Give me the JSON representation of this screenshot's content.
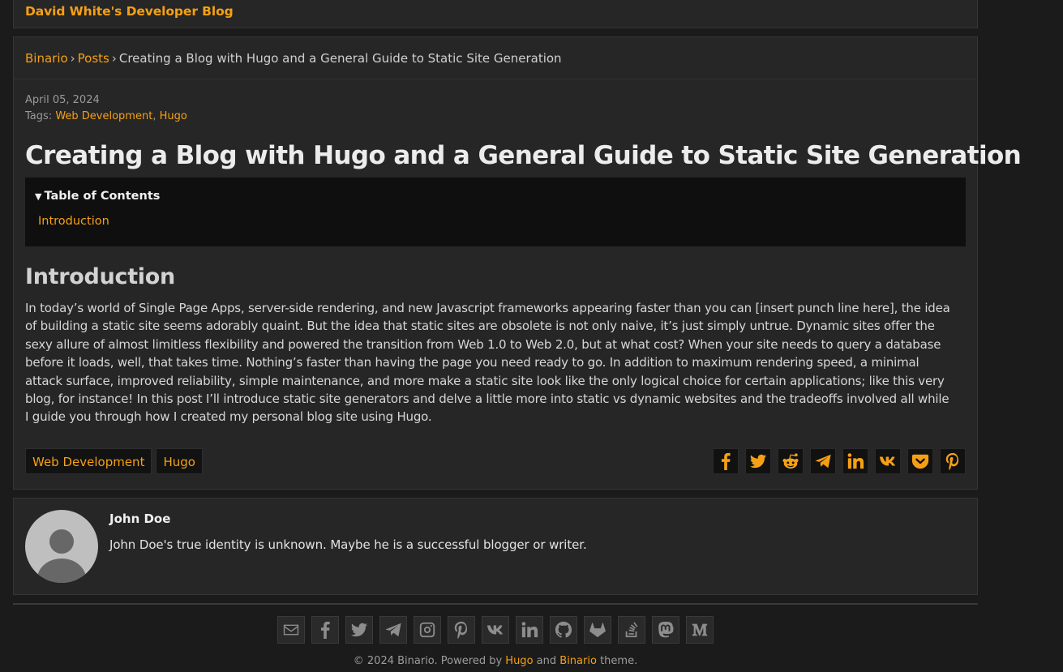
{
  "header": {
    "site_title": "David White's Developer Blog"
  },
  "breadcrumb": {
    "home": "Binario",
    "section": "Posts",
    "current": "Creating a Blog with Hugo and a General Guide to Static Site Generation"
  },
  "meta": {
    "date": "April 05, 2024",
    "tags_label": "Tags:",
    "tags": [
      "Web Development",
      "Hugo"
    ],
    "tag_separator": ","
  },
  "post": {
    "title": "Creating a Blog with Hugo and a General Guide to Static Site Generation",
    "toc": {
      "heading": "Table of Contents",
      "items": [
        "Introduction"
      ]
    },
    "section_title": "Introduction",
    "body": "In today’s world of Single Page Apps, server-side rendering, and new Javascript frameworks appearing faster than you can [insert punch line here], the idea of building a static site seems adorably quaint. But the idea that static sites are obsolete is not only naive, it’s just simply untrue. Dynamic sites offer the sexy allure of almost limitless flexibility and powered the transition from Web 1.0 to Web 2.0, but at what cost? When your site needs to query a database before it loads, well, that takes time. Nothing’s faster than having the page you need ready to go. In addition to maximum rendering speed, a minimal attack surface, improved reliability, simple maintenance, and more make a static site look like the only logical choice for certain applications; like this very blog, for instance! In this post I’ll introduce static site generators and delve a little more into static vs dynamic websites and the tradeoffs involved all while I guide you through how I created my personal blog site using Hugo.",
    "tags": [
      "Web Development",
      "Hugo"
    ],
    "share_icons": [
      "facebook-icon",
      "twitter-icon",
      "reddit-icon",
      "telegram-icon",
      "linkedin-icon",
      "vk-icon",
      "pocket-icon",
      "pinterest-icon"
    ]
  },
  "author": {
    "name": "John Doe",
    "bio": "John Doe's true identity is unknown. Maybe he is a successful blogger or writer."
  },
  "footer": {
    "social_icons": [
      "email-icon",
      "facebook-icon",
      "twitter-icon",
      "telegram-icon",
      "instagram-icon",
      "pinterest-icon",
      "vk-icon",
      "linkedin-icon",
      "github-icon",
      "gitlab-icon",
      "stackoverflow-icon",
      "mastodon-icon",
      "medium-icon"
    ],
    "copyright_prefix": "© 2024 Binario. Powered by",
    "hugo_link": "Hugo",
    "and_text": "and",
    "theme_link": "Binario",
    "theme_suffix": "theme."
  },
  "colors": {
    "accent": "#f5a014",
    "background": "#1b1b1b",
    "card": "#262626",
    "toc_background": "#0f0f0f",
    "footer_icon": "#8d8d8d"
  }
}
